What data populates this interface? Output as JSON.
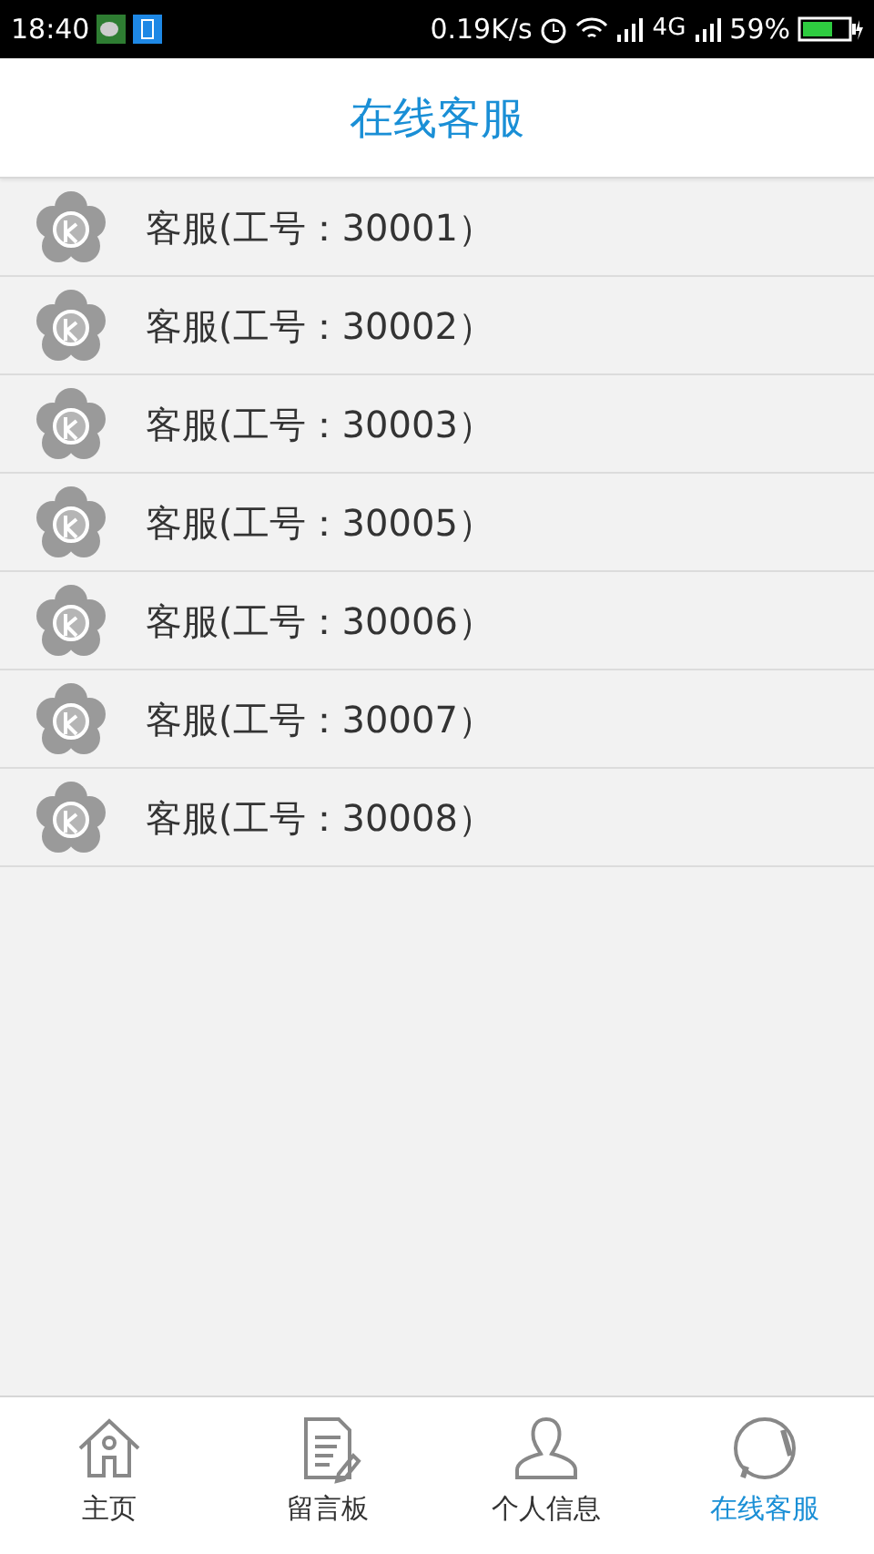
{
  "status_bar": {
    "time": "18:40",
    "speed": "0.19K/s",
    "network": "4G",
    "battery": "59%"
  },
  "header": {
    "title": "在线客服"
  },
  "agents": [
    {
      "name": "客服(工号：30001）"
    },
    {
      "name": "客服(工号：30002）"
    },
    {
      "name": "客服(工号：30003）"
    },
    {
      "name": "客服(工号：30005）"
    },
    {
      "name": "客服(工号：30006）"
    },
    {
      "name": "客服(工号：30007）"
    },
    {
      "name": "客服(工号：30008）"
    }
  ],
  "bottom_nav": [
    {
      "label": "主页",
      "kind": "home",
      "selected": false
    },
    {
      "label": "留言板",
      "kind": "note",
      "selected": false
    },
    {
      "label": "个人信息",
      "kind": "person",
      "selected": false
    },
    {
      "label": "在线客服",
      "kind": "headset",
      "selected": true
    }
  ]
}
